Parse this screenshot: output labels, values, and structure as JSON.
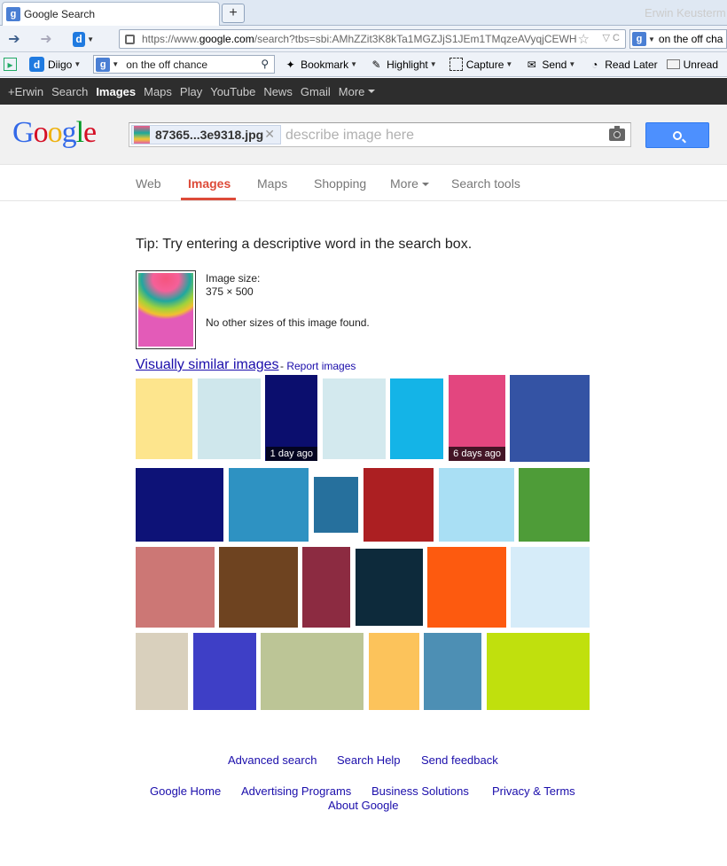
{
  "browser": {
    "tab_title": "Google Search",
    "new_tab_symbol": "+",
    "url_prefix": "https://www.",
    "url_domain": "google.com",
    "url_rest": "/search?tbs=sbi:AMhZZit3K8kTa1MGZJjS1JEm1TMqzeAVyqjCEWH",
    "search_value": "on the off cha"
  },
  "toolbar": {
    "diigo": "Diigo",
    "search_value": "on the off chance",
    "bookmark": "Bookmark",
    "highlight": "Highlight",
    "capture": "Capture",
    "send": "Send",
    "read_later": "Read Later",
    "unread": "Unread"
  },
  "gbar": {
    "items": [
      "+Erwin",
      "Search",
      "Images",
      "Maps",
      "Play",
      "YouTube",
      "News",
      "Gmail",
      "More"
    ],
    "active": "Images",
    "user": "Erwin Keusterm"
  },
  "search": {
    "chip_name": "87365...3e9318.jpg",
    "placeholder": "describe image here"
  },
  "tabs": [
    "Web",
    "Images",
    "Maps",
    "Shopping",
    "More",
    "Search tools"
  ],
  "content": {
    "tip": "Tip: Try entering a descriptive word in the search box.",
    "image_size_label": "Image size:",
    "image_size_value": "375 × 500",
    "no_other_sizes": "No other sizes of this image found.",
    "visually_similar": "Visually similar images",
    "report_sep": " - ",
    "report": "Report images"
  },
  "thumbs": [
    {
      "color": "#fde58d",
      "badge": ""
    },
    {
      "color": "#cfe7ec",
      "badge": ""
    },
    {
      "color": "#0b0e6e",
      "badge": "1 day ago"
    },
    {
      "color": "#d3e9ee",
      "badge": ""
    },
    {
      "color": "#14b4e7",
      "badge": ""
    },
    {
      "color": "#e3467f",
      "badge": "6 days ago"
    },
    {
      "color": "#3453a4",
      "badge": ""
    },
    {
      "color": "#0d1277",
      "badge": ""
    },
    {
      "color": "#2e92c2",
      "badge": ""
    },
    {
      "color": "#26709d",
      "badge": ""
    },
    {
      "color": "#ac1f22",
      "badge": ""
    },
    {
      "color": "#a9dff4",
      "badge": ""
    },
    {
      "color": "#4e9c38",
      "badge": ""
    },
    {
      "color": "#cc7775",
      "badge": ""
    },
    {
      "color": "#6e4320",
      "badge": ""
    },
    {
      "color": "#8c2b41",
      "badge": ""
    },
    {
      "color": "#0d2a3b",
      "badge": ""
    },
    {
      "color": "#fd5a0f",
      "badge": ""
    },
    {
      "color": "#d6ecf9",
      "badge": ""
    },
    {
      "color": "#d9d0bd",
      "badge": ""
    },
    {
      "color": "#3e3fc6",
      "badge": ""
    },
    {
      "color": "#bcc596",
      "badge": ""
    },
    {
      "color": "#fcc35b",
      "badge": ""
    },
    {
      "color": "#4d8fb4",
      "badge": ""
    },
    {
      "color": "#c0e00d",
      "badge": ""
    }
  ],
  "footer": {
    "row1": [
      "Advanced search",
      "Search Help",
      "Send feedback"
    ],
    "row2": [
      "Google Home",
      "Advertising Programs",
      "Business Solutions",
      "Privacy & Terms"
    ],
    "row3": "About Google"
  }
}
